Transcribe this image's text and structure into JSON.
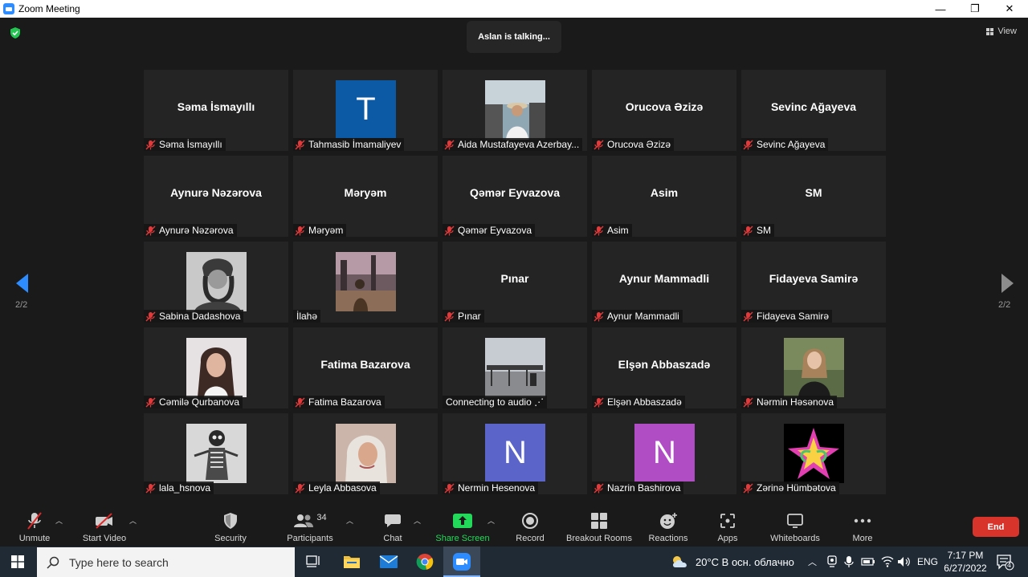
{
  "window": {
    "title": "Zoom Meeting",
    "minimize": "—",
    "restore": "❐",
    "close": "✕"
  },
  "meeting": {
    "talking": "Aslan is talking...",
    "view_label": "View",
    "page_left": "2/2",
    "page_right": "2/2",
    "tiles": [
      {
        "big": "Səma İsmayıllı",
        "label": "Səma İsmayıllı",
        "kind": "name"
      },
      {
        "big": "",
        "label": "Tahmasib İmamaliyev",
        "kind": "letter",
        "letter": "T",
        "color": "#0c5aa6"
      },
      {
        "big": "",
        "label": "Aida Mustafayeva Azerbay...",
        "kind": "photo",
        "photo": "aida"
      },
      {
        "big": "Orucova Əzizə",
        "label": "Orucova Əzizə",
        "kind": "name"
      },
      {
        "big": "Sevinc Ağayeva",
        "label": "Sevinc Ağayeva",
        "kind": "name"
      },
      {
        "big": "Aynurə Nəzərova",
        "label": "Aynurə Nəzərova",
        "kind": "name"
      },
      {
        "big": "Məryəm",
        "label": "Məryəm",
        "kind": "name"
      },
      {
        "big": "Qəmər Eyvazova",
        "label": "Qəmər Eyvazova",
        "kind": "name"
      },
      {
        "big": "Asim",
        "label": "Asim",
        "kind": "name"
      },
      {
        "big": "SM",
        "label": "SM",
        "kind": "name"
      },
      {
        "big": "",
        "label": "Sabina Dadashova",
        "kind": "photo",
        "photo": "sabina"
      },
      {
        "big": "",
        "label": "İlahə",
        "kind": "photo",
        "photo": "ilahe",
        "nomic": true
      },
      {
        "big": "Pınar",
        "label": "Pınar",
        "kind": "name"
      },
      {
        "big": "Aynur Mammadli",
        "label": "Aynur Mammadli",
        "kind": "name"
      },
      {
        "big": "Fidayeva Samirə",
        "label": "Fidayeva Samirə",
        "kind": "name"
      },
      {
        "big": "",
        "label": "Cəmilə Qurbanova",
        "kind": "photo",
        "photo": "jamila"
      },
      {
        "big": "Fatima Bazarova",
        "label": "Fatima Bazarova",
        "kind": "name"
      },
      {
        "big": "",
        "label": "Connecting to audio ⋰",
        "kind": "photo",
        "photo": "connecting",
        "nomic": true
      },
      {
        "big": "Elşən Abbaszadə",
        "label": "Elşən Abbaszadə",
        "kind": "name"
      },
      {
        "big": "",
        "label": "Nərmin Həsənova",
        "kind": "photo",
        "photo": "nermin"
      },
      {
        "big": "",
        "label": "lala_hsnova",
        "kind": "photo",
        "photo": "lala"
      },
      {
        "big": "",
        "label": "Leyla Abbasova",
        "kind": "photo",
        "photo": "leyla"
      },
      {
        "big": "",
        "label": "Nermin Hesenova",
        "kind": "letter",
        "letter": "N",
        "color": "#5b64c9"
      },
      {
        "big": "",
        "label": "Nazrin Bashirova",
        "kind": "letter",
        "letter": "N",
        "color": "#b04cc4"
      },
      {
        "big": "",
        "label": "Zərinə Hümbətova",
        "kind": "photo",
        "photo": "flower"
      }
    ]
  },
  "toolbar": {
    "unmute": "Unmute",
    "start_video": "Start Video",
    "security": "Security",
    "participants": "Participants",
    "participants_count": "34",
    "chat": "Chat",
    "share_screen": "Share Screen",
    "record": "Record",
    "breakout": "Breakout Rooms",
    "reactions": "Reactions",
    "apps": "Apps",
    "whiteboards": "Whiteboards",
    "more": "More",
    "end": "End",
    "share_color": "#23d959",
    "end_color": "#d9342b"
  },
  "taskbar": {
    "search_placeholder": "Type here to search",
    "weather": "20°C  В осн. облачно",
    "lang": "ENG",
    "time": "7:17 PM",
    "date": "6/27/2022",
    "notif_count": "4"
  }
}
